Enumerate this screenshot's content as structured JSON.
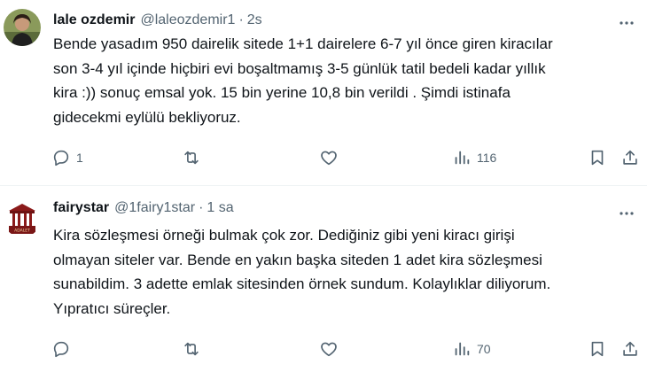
{
  "tweets": [
    {
      "name": "lale ozdemir",
      "handle": "@laleozdemir1",
      "separator": "·",
      "time": "2s",
      "lines": [
        "Bende yasadım 950 dairelik sitede 1+1 dairelere 6-7 yıl önce giren kiracılar",
        "son 3-4 yıl içinde hiçbiri evi boşaltmamış 3-5 günlük tatil bedeli kadar yıllık",
        "kira :)) sonuç  emsal yok. 15 bin yerine 10,8 bin verildi . Şimdi istinafa",
        "gidecekmi eylülü bekliyoruz."
      ],
      "replies": "1",
      "retweets": "",
      "likes": "",
      "views": "116",
      "icons": [
        "more-icon",
        "reply-icon",
        "retweet-icon",
        "like-icon",
        "views-icon",
        "bookmark-icon",
        "share-icon"
      ]
    },
    {
      "name": "fairystar",
      "handle": "@1fairy1star",
      "separator": "·",
      "time": "1 sa",
      "avatar_text": "ADALET",
      "lines": [
        "Kira sözleşmesi örneği bulmak çok zor. Dediğiniz gibi yeni kiracı girişi",
        "olmayan siteler var. Bende en yakın başka siteden 1 adet kira sözleşmesi",
        "sunabildim. 3 adette emlak sitesinden örnek sundum. Kolaylıklar diliyorum.",
        "Yıpratıcı süreçler."
      ],
      "replies": "",
      "retweets": "",
      "likes": "",
      "views": "70",
      "icons": [
        "more-icon",
        "reply-icon",
        "retweet-icon",
        "like-icon",
        "views-icon",
        "bookmark-icon",
        "share-icon"
      ]
    }
  ],
  "colors": {
    "text": "#0f1419",
    "secondary": "#536471",
    "divider": "#eff3f4",
    "background": "#ffffff"
  }
}
